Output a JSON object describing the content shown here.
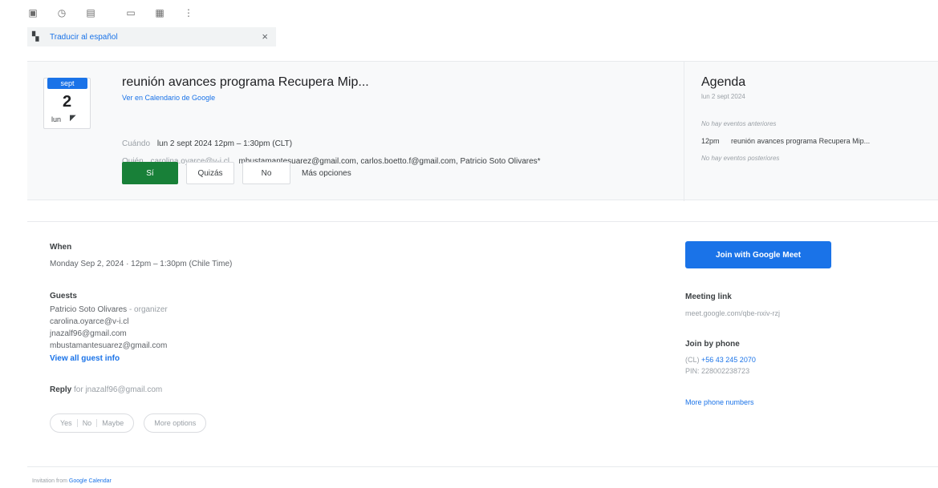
{
  "toolbar": {
    "icons": [
      "archive-icon",
      "snooze-icon",
      "tasks-icon",
      "move-icon",
      "labels-icon",
      "more-icon"
    ]
  },
  "translate": {
    "link": "Traducir al español",
    "close": "×"
  },
  "invite": {
    "month": "sept",
    "day": "2",
    "dow": "lun",
    "title": "reunión avances programa Recupera Mip...",
    "calendar_link": "Ver en Calendario de Google",
    "when_label": "Cuándo",
    "when_value": "lun 2 sept 2024 12pm – 1:30pm (CLT)",
    "who_label": "Quién",
    "who_value_muted": "carolina.oyarce@v-i.cl,",
    "who_value": "mbustamantesuarez@gmail.com, carlos.boetto.f@gmail.com, Patricio Soto Olivares*",
    "rsvp": {
      "yes": "Sí",
      "maybe": "Quizás",
      "no": "No",
      "more": "Más opciones"
    }
  },
  "agenda": {
    "title": "Agenda",
    "date": "lun 2 sept 2024",
    "no_prev": "No hay eventos anteriores",
    "time": "12pm",
    "event": "reunión avances programa Recupera Mip...",
    "no_next": "No hay eventos posteriores"
  },
  "details": {
    "when_heading": "When",
    "when_value": "Monday Sep 2, 2024 · 12pm – 1:30pm (Chile Time)",
    "guests_heading": "Guests",
    "organizer_name": "Patricio Soto Olivares",
    "organizer_tag": "- organizer",
    "guest_1": "carolina.oyarce@v-i.cl",
    "guest_2": "jnazalf96@gmail.com",
    "guest_3": "mbustamantesuarez@gmail.com",
    "view_all": "View all guest info",
    "reply_label": "Reply",
    "reply_for": "for jnazalf96@gmail.com",
    "reply_yes": "Yes",
    "reply_no": "No",
    "reply_maybe": "Maybe",
    "reply_more": "More options"
  },
  "meet": {
    "button": "Join with Google Meet",
    "link_heading": "Meeting link",
    "link_value": "meet.google.com/qbe-nxiv-rzj",
    "phone_heading": "Join by phone",
    "phone_prefix": "(CL)",
    "phone_number": "+56 43 245 2070",
    "pin": "PIN: 228002238723",
    "more_numbers": "More phone numbers"
  },
  "footer": {
    "prefix": "Invitation from",
    "link": "Google Calendar"
  },
  "colors": {
    "accent": "#1a73e8",
    "yes_green": "#188038"
  }
}
